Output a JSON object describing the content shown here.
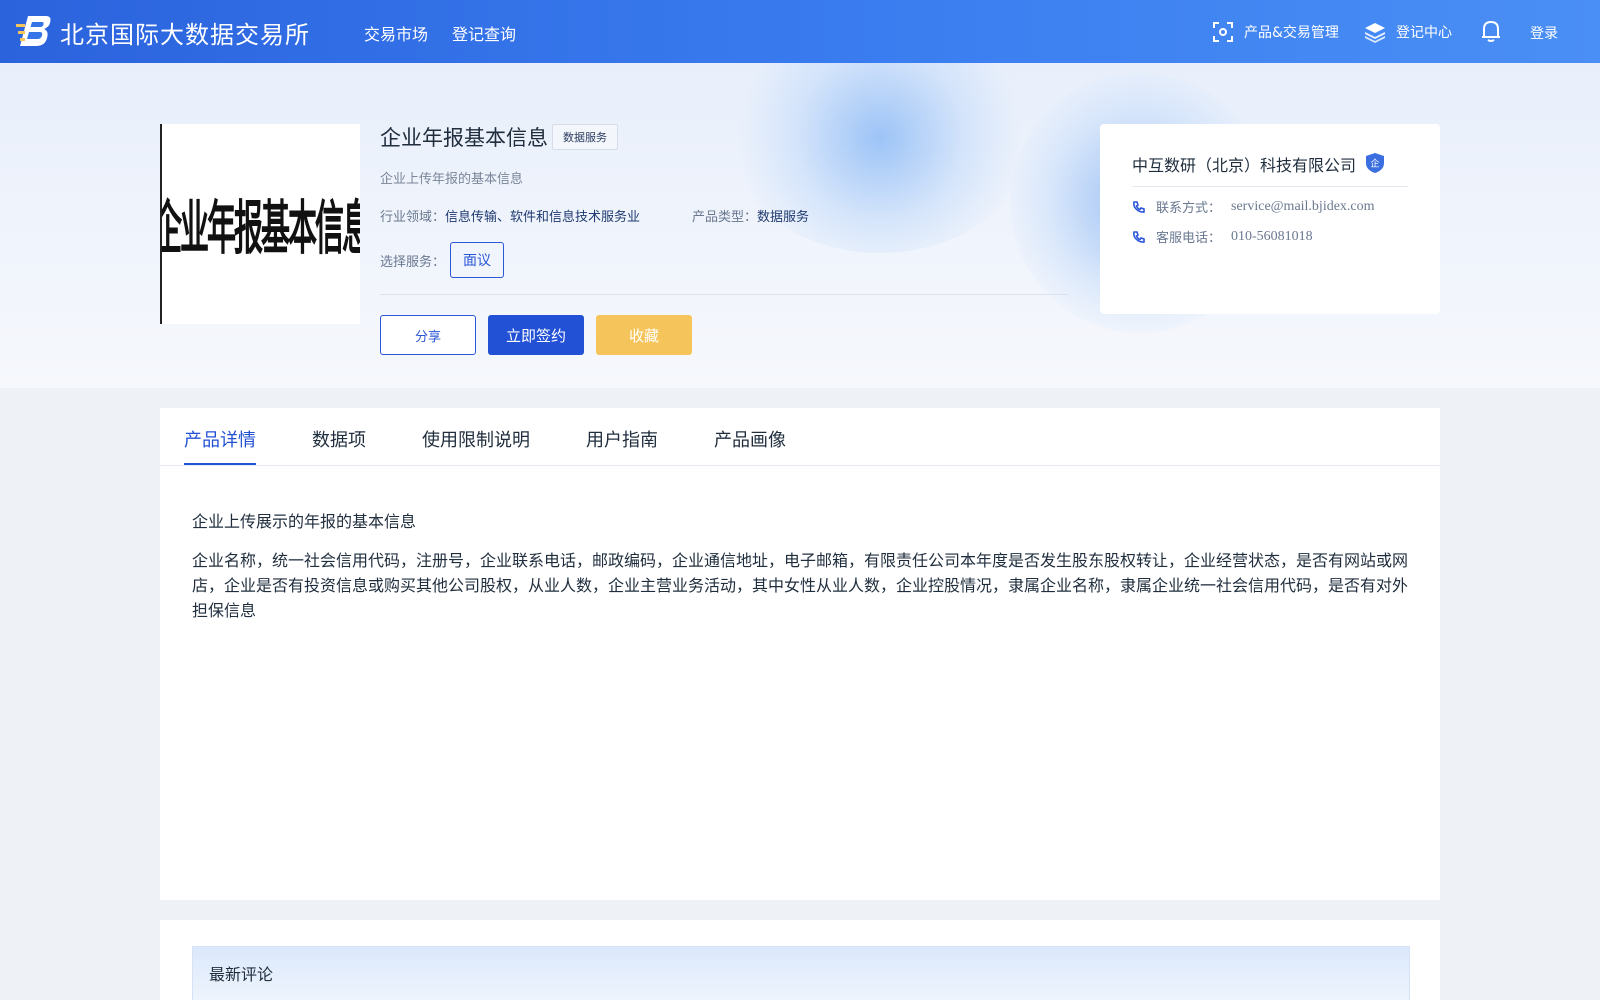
{
  "header": {
    "site_name": "北京国际大数据交易所",
    "nav": [
      "交易市场",
      "登记查询"
    ],
    "product_mgmt": "产品&交易管理",
    "register_center": "登记中心",
    "login": "登录"
  },
  "product": {
    "image_text": "企业年报基本信息",
    "title": "企业年报基本信息",
    "tag": "数据服务",
    "description": "企业上传年报的基本信息",
    "industry_label": "行业领域：",
    "industry_value": "信息传输、软件和信息技术服务业",
    "type_label": "产品类型：",
    "type_value": "数据服务",
    "select_label": "选择服务：",
    "service_option": "面议",
    "buttons": {
      "share": "分享",
      "sign": "立即签约",
      "favorite": "收藏"
    }
  },
  "seller": {
    "name": "中互数研（北京）科技有限公司",
    "badge": "企",
    "contact_label": "联系方式：",
    "contact_value": "service@mail.bjidex.com",
    "phone_label": "客服电话：",
    "phone_value": "010-56081018"
  },
  "tabs": [
    "产品详情",
    "数据项",
    "使用限制说明",
    "用户指南",
    "产品画像"
  ],
  "active_tab": "产品详情",
  "detail": {
    "summary": "企业上传展示的年报的基本信息",
    "fields": "企业名称，统一社会信用代码，注册号，企业联系电话，邮政编码，企业通信地址，电子邮箱，有限责任公司本年度是否发生股东股权转让，企业经营状态，是否有网站或网店，企业是否有投资信息或购买其他公司股权，从业人数，企业主营业务活动，其中女性从业人数，企业控股情况，隶属企业名称，隶属企业统一社会信用代码，是否有对外担保信息"
  },
  "comments": {
    "title": "最新评论"
  },
  "colors": {
    "primary": "#2251d6",
    "favorite": "#f5c55b",
    "header_start": "#2b63dd",
    "header_end": "#4a8ff5"
  }
}
